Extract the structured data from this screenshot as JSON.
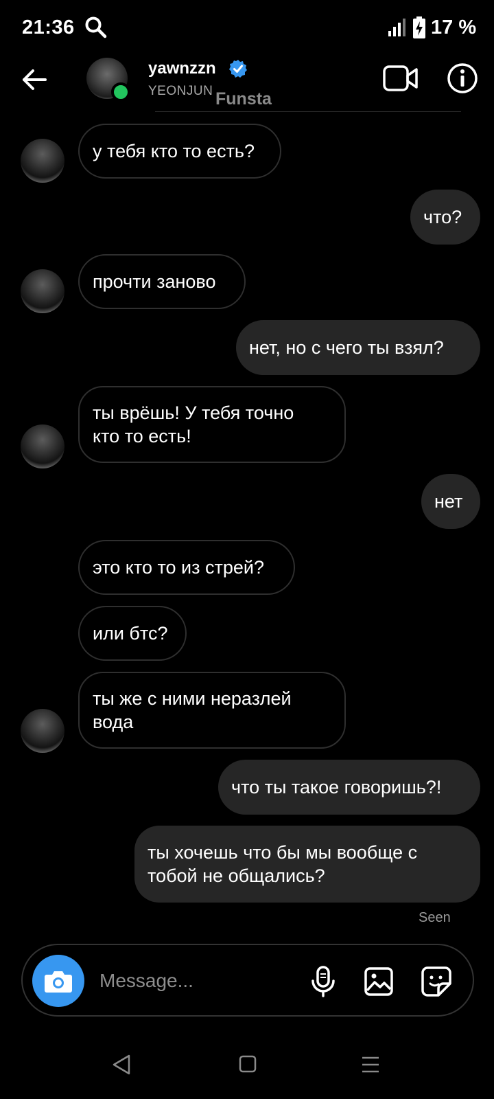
{
  "status_bar": {
    "time": "21:36",
    "battery": "17 %"
  },
  "header": {
    "username": "yawnzzn",
    "subtitle": "YEONJUN",
    "watermark": "Funsta",
    "verified_color": "#3797f0",
    "online_color": "#22c55e"
  },
  "messages": [
    {
      "side": "in",
      "text": "у тебя кто то есть?",
      "avatar": true
    },
    {
      "side": "out",
      "text": "что?"
    },
    {
      "side": "in",
      "text": "прочти заново",
      "avatar": true
    },
    {
      "side": "out",
      "text": "нет, но с чего ты взял?"
    },
    {
      "side": "in",
      "text": "ты врёшь! У тебя точно кто то есть!",
      "avatar": true
    },
    {
      "side": "out",
      "text": "нет"
    },
    {
      "side": "in",
      "text": "это кто то из стрей?",
      "avatar": false
    },
    {
      "side": "in",
      "text": "или бтс?",
      "avatar": false
    },
    {
      "side": "in",
      "text": "ты же с ними неразлей вода",
      "avatar": true
    },
    {
      "side": "out",
      "text": "что ты такое говоришь?!"
    },
    {
      "side": "out",
      "text": "ты хочешь что бы мы вообще с тобой не общались?"
    }
  ],
  "seen_label": "Seen",
  "composer": {
    "placeholder": "Message...",
    "camera_color": "#3797f0"
  },
  "icons": {
    "search": "search-icon",
    "back": "back-arrow-icon",
    "video": "video-camera-icon",
    "info": "info-icon",
    "camera": "camera-icon",
    "mic": "microphone-icon",
    "gallery": "gallery-icon",
    "sticker": "sticker-icon"
  }
}
